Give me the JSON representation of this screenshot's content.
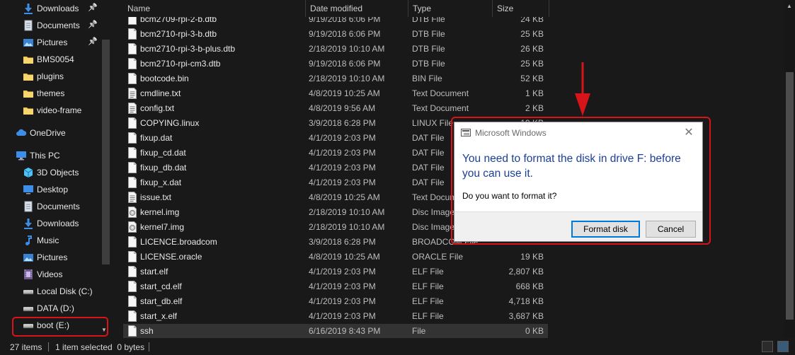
{
  "sidebar": {
    "items": [
      {
        "label": "Downloads",
        "icon": "download-icon",
        "pinned": true
      },
      {
        "label": "Documents",
        "icon": "document-icon",
        "pinned": true
      },
      {
        "label": "Pictures",
        "icon": "pictures-icon",
        "pinned": true
      },
      {
        "label": "BMS0054",
        "icon": "folder-icon",
        "pinned": false
      },
      {
        "label": "plugins",
        "icon": "folder-icon",
        "pinned": false
      },
      {
        "label": "themes",
        "icon": "folder-icon",
        "pinned": false
      },
      {
        "label": "video-frame",
        "icon": "folder-icon",
        "pinned": false
      },
      {
        "label": "OneDrive",
        "icon": "cloud-icon",
        "pinned": false
      },
      {
        "label": "This PC",
        "icon": "computer-icon",
        "pinned": false
      },
      {
        "label": "3D Objects",
        "icon": "cube-icon",
        "pinned": false
      },
      {
        "label": "Desktop",
        "icon": "desktop-icon",
        "pinned": false
      },
      {
        "label": "Documents",
        "icon": "document-icon",
        "pinned": false
      },
      {
        "label": "Downloads",
        "icon": "download-icon",
        "pinned": false
      },
      {
        "label": "Music",
        "icon": "music-icon",
        "pinned": false
      },
      {
        "label": "Pictures",
        "icon": "pictures-icon",
        "pinned": false
      },
      {
        "label": "Videos",
        "icon": "videos-icon",
        "pinned": false
      },
      {
        "label": "Local Disk (C:)",
        "icon": "drive-icon",
        "pinned": false
      },
      {
        "label": "DATA (D:)",
        "icon": "drive-icon",
        "pinned": false
      },
      {
        "label": "boot (E:)",
        "icon": "drive-icon",
        "pinned": false
      }
    ]
  },
  "columns": {
    "name": "Name",
    "date": "Date modified",
    "type": "Type",
    "size": "Size"
  },
  "files": [
    {
      "name": "bcm2709-rpi-2-b.dtb",
      "date": "9/19/2018 6:06 PM",
      "type": "DTB File",
      "size": "24 KB",
      "icon": "file-icon"
    },
    {
      "name": "bcm2710-rpi-3-b.dtb",
      "date": "9/19/2018 6:06 PM",
      "type": "DTB File",
      "size": "25 KB",
      "icon": "file-icon"
    },
    {
      "name": "bcm2710-rpi-3-b-plus.dtb",
      "date": "2/18/2019 10:10 AM",
      "type": "DTB File",
      "size": "26 KB",
      "icon": "file-icon"
    },
    {
      "name": "bcm2710-rpi-cm3.dtb",
      "date": "9/19/2018 6:06 PM",
      "type": "DTB File",
      "size": "25 KB",
      "icon": "file-icon"
    },
    {
      "name": "bootcode.bin",
      "date": "2/18/2019 10:10 AM",
      "type": "BIN File",
      "size": "52 KB",
      "icon": "file-icon"
    },
    {
      "name": "cmdline.txt",
      "date": "4/8/2019 10:25 AM",
      "type": "Text Document",
      "size": "1 KB",
      "icon": "text-file-icon"
    },
    {
      "name": "config.txt",
      "date": "4/8/2019 9:56 AM",
      "type": "Text Document",
      "size": "2 KB",
      "icon": "text-file-icon"
    },
    {
      "name": "COPYING.linux",
      "date": "3/9/2018 6:28 PM",
      "type": "LINUX File",
      "size": "19 KB",
      "icon": "file-icon"
    },
    {
      "name": "fixup.dat",
      "date": "4/1/2019 2:03 PM",
      "type": "DAT File",
      "size": "",
      "icon": "file-icon"
    },
    {
      "name": "fixup_cd.dat",
      "date": "4/1/2019 2:03 PM",
      "type": "DAT File",
      "size": "",
      "icon": "file-icon"
    },
    {
      "name": "fixup_db.dat",
      "date": "4/1/2019 2:03 PM",
      "type": "DAT File",
      "size": "",
      "icon": "file-icon"
    },
    {
      "name": "fixup_x.dat",
      "date": "4/1/2019 2:03 PM",
      "type": "DAT File",
      "size": "",
      "icon": "file-icon"
    },
    {
      "name": "issue.txt",
      "date": "4/8/2019 10:25 AM",
      "type": "Text Document",
      "size": "",
      "icon": "text-file-icon"
    },
    {
      "name": "kernel.img",
      "date": "2/18/2019 10:10 AM",
      "type": "Disc Image File",
      "size": "",
      "icon": "disc-image-icon"
    },
    {
      "name": "kernel7.img",
      "date": "2/18/2019 10:10 AM",
      "type": "Disc Image File",
      "size": "",
      "icon": "disc-image-icon"
    },
    {
      "name": "LICENCE.broadcom",
      "date": "3/9/2018 6:28 PM",
      "type": "BROADCOM File",
      "size": "",
      "icon": "file-icon"
    },
    {
      "name": "LICENSE.oracle",
      "date": "4/8/2019 10:25 AM",
      "type": "ORACLE File",
      "size": "19 KB",
      "icon": "file-icon"
    },
    {
      "name": "start.elf",
      "date": "4/1/2019 2:03 PM",
      "type": "ELF File",
      "size": "2,807 KB",
      "icon": "file-icon"
    },
    {
      "name": "start_cd.elf",
      "date": "4/1/2019 2:03 PM",
      "type": "ELF File",
      "size": "668 KB",
      "icon": "file-icon"
    },
    {
      "name": "start_db.elf",
      "date": "4/1/2019 2:03 PM",
      "type": "ELF File",
      "size": "4,718 KB",
      "icon": "file-icon"
    },
    {
      "name": "start_x.elf",
      "date": "4/1/2019 2:03 PM",
      "type": "ELF File",
      "size": "3,687 KB",
      "icon": "file-icon"
    },
    {
      "name": "ssh",
      "date": "6/16/2019 8:43 PM",
      "type": "File",
      "size": "0 KB",
      "icon": "file-icon",
      "selected": true
    }
  ],
  "status": {
    "count": "27 items",
    "selection": "1 item selected  0 bytes"
  },
  "dialog": {
    "title": "Microsoft Windows",
    "heading": "You need to format the disk in drive F: before you can use it.",
    "message": "Do you want to format it?",
    "primary_button": "Format disk",
    "secondary_button": "Cancel",
    "close_glyph": "✕"
  },
  "colors": {
    "background": "#191919",
    "selected_row": "#333333",
    "accent": "#0078d7",
    "heading": "#1b3f97",
    "annotation": "#d7141a",
    "folder": "#f2c94c"
  }
}
